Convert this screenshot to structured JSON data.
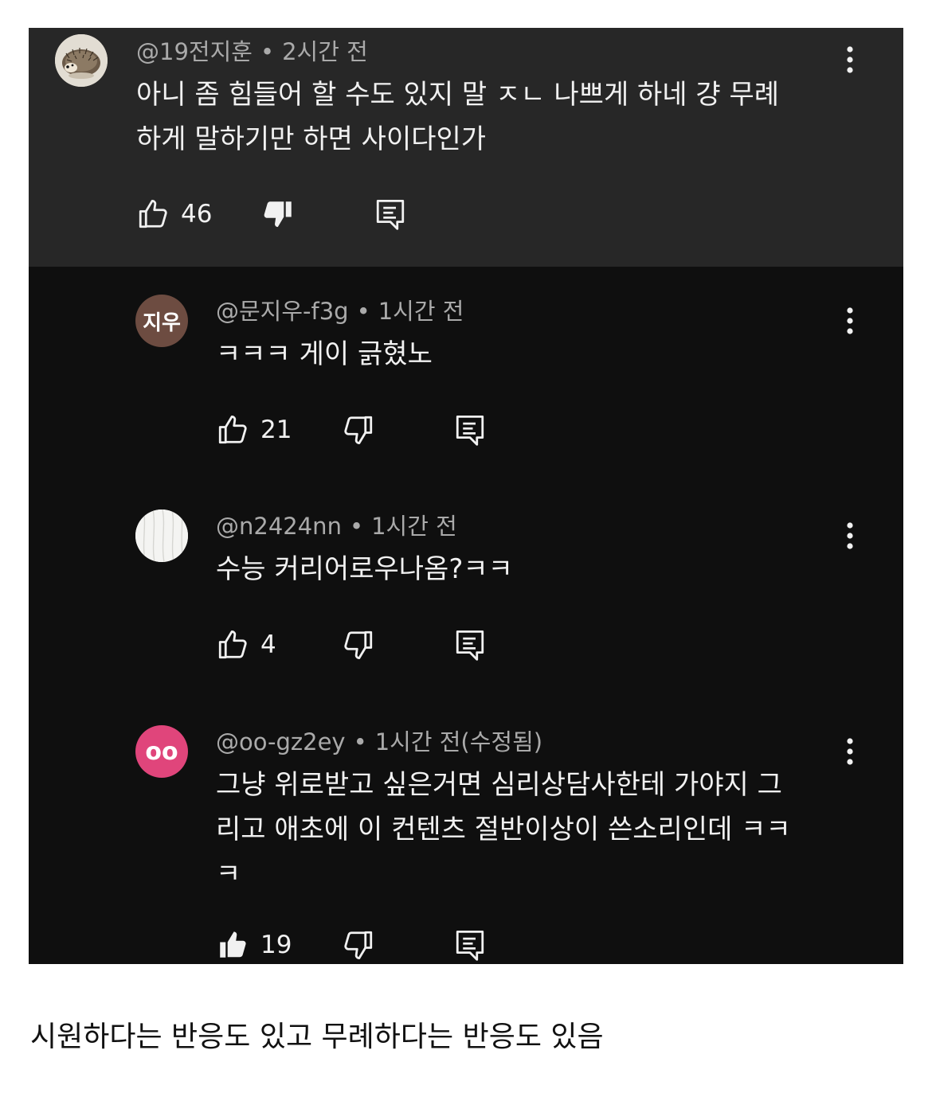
{
  "comments": [
    {
      "author": "@19전지훈",
      "time": "2시간 전",
      "avatar": {
        "type": "image",
        "depicts": "hedgehog-photo"
      },
      "lines": [
        "아니 좀 힘들어 할 수도 있지 말 ㅈㄴ 나쁘게 하네 걍 무례",
        "하게 말하기만 하면 사이다인가"
      ],
      "likes": "46",
      "liked": false,
      "disliked": true
    },
    {
      "author": "@문지우-f3g",
      "time": "1시간 전",
      "avatar": {
        "type": "text",
        "text": "지우",
        "color": "#6d4c41"
      },
      "lines": [
        "ㅋㅋㅋ 게이 긁혔노"
      ],
      "likes": "21",
      "liked": false,
      "disliked": false
    },
    {
      "author": "@n2424nn",
      "time": "1시간 전",
      "avatar": {
        "type": "image",
        "depicts": "white-fabric"
      },
      "lines": [
        "수능 커리어로우나옴?ㅋㅋ"
      ],
      "likes": "4",
      "liked": false,
      "disliked": false
    },
    {
      "author": "@oo-gz2ey",
      "time": "1시간 전(수정됨)",
      "avatar": {
        "type": "text",
        "text": "oo",
        "color": "#e0457b"
      },
      "lines": [
        "그냥 위로받고 싶은거면 심리상담사한테 가야지 그",
        "리고 애초에 이 컨텐츠 절반이상이 쓴소리인데 ㅋㅋ",
        "ㅋ"
      ],
      "likes": "19",
      "liked": true,
      "disliked": false
    }
  ],
  "caption": "시원하다는 반응도 있고 무례하다는 반응도 있음",
  "colors": {
    "panel": "#0f0f0f",
    "highlight": "#272727",
    "text": "#f1f1f1",
    "meta": "#aaaaaa"
  }
}
